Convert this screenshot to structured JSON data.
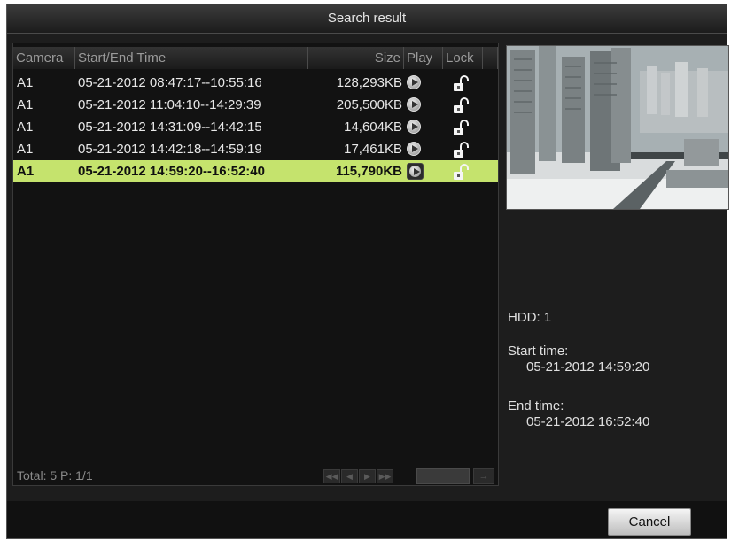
{
  "window": {
    "title": "Search result"
  },
  "table": {
    "headers": {
      "camera": "Camera",
      "time": "Start/End Time",
      "size": "Size",
      "play": "Play",
      "lock": "Lock"
    },
    "rows": [
      {
        "camera": "A1",
        "time": "05-21-2012 08:47:17--10:55:16",
        "size": "128,293KB",
        "selected": false
      },
      {
        "camera": "A1",
        "time": "05-21-2012 11:04:10--14:29:39",
        "size": "205,500KB",
        "selected": false
      },
      {
        "camera": "A1",
        "time": "05-21-2012 14:31:09--14:42:15",
        "size": "14,604KB",
        "selected": false
      },
      {
        "camera": "A1",
        "time": "05-21-2012 14:42:18--14:59:19",
        "size": "17,461KB",
        "selected": false
      },
      {
        "camera": "A1",
        "time": "05-21-2012 14:59:20--16:52:40",
        "size": "115,790KB",
        "selected": true
      }
    ],
    "footer": {
      "total": "Total: 5  P: 1/1"
    }
  },
  "details": {
    "hdd": "HDD: 1",
    "start_label": "Start time:",
    "start_value": "05-21-2012 14:59:20",
    "end_label": "End time:",
    "end_value": "05-21-2012 16:52:40"
  },
  "buttons": {
    "cancel": "Cancel"
  },
  "colors": {
    "selected_row": "#c5e36d",
    "background": "#0e0e0e"
  },
  "icons": {
    "play": "play-circle-icon",
    "lock": "unlocked-padlock-icon"
  }
}
